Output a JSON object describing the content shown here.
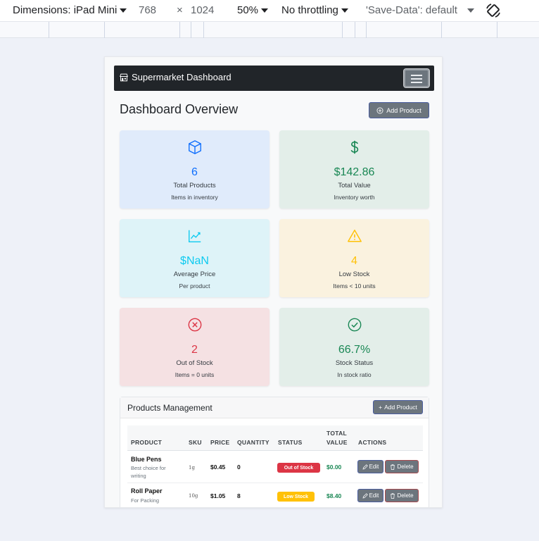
{
  "devtools": {
    "dimensions_label": "Dimensions: iPad Mini",
    "width": "768",
    "times": "×",
    "height": "1024",
    "zoom": "50%",
    "throttling": "No throttling",
    "save_data": "'Save-Data': default"
  },
  "navbar": {
    "brand": "Supermarket Dashboard"
  },
  "page": {
    "title": "Dashboard Overview",
    "add_product_label": "Add Product"
  },
  "cards": [
    {
      "value": "6",
      "label": "Total Products",
      "sub": "Items in inventory",
      "icon": "box-icon",
      "color": "#0d6efd",
      "bg": "#e0ebfb"
    },
    {
      "value": "$142.86",
      "label": "Total Value",
      "sub": "Inventory worth",
      "icon": "dollar-icon",
      "color": "#198754",
      "bg": "#e3eee9"
    },
    {
      "value": "$NaN",
      "label": "Average Price",
      "sub": "Per product",
      "icon": "chart-line-icon",
      "color": "#0dcaf0",
      "bg": "#def3f8"
    },
    {
      "value": "4",
      "label": "Low Stock",
      "sub": "Items < 10 units",
      "icon": "warning-icon",
      "color": "#ffc107",
      "bg": "#faf2df"
    },
    {
      "value": "2",
      "label": "Out of Stock",
      "sub": "Items = 0 units",
      "icon": "x-circle-icon",
      "color": "#dc3545",
      "bg": "#f5e1e3"
    },
    {
      "value": "66.7%",
      "label": "Stock Status",
      "sub": "In stock ratio",
      "icon": "check-circle-icon",
      "color": "#198754",
      "bg": "#e3eee9"
    }
  ],
  "products": {
    "title": "Products Management",
    "add_label": "Add Product",
    "columns": [
      "PRODUCT",
      "SKU",
      "PRICE",
      "QUANTITY",
      "STATUS",
      "TOTAL",
      "VALUE",
      "ACTIONS"
    ],
    "rows": [
      {
        "name": "Blue Pens",
        "desc1": "Best choice for",
        "desc2": "writing",
        "sku": "1g",
        "price": "$0.45",
        "quantity": "0",
        "status": "Out of Stock",
        "status_bg": "#dc3545",
        "status_fg": "#ffffff",
        "total": "$0.00"
      },
      {
        "name": "Roll Paper",
        "desc1": "For Packing",
        "desc2": "",
        "sku": "10g",
        "price": "$1.05",
        "quantity": "8",
        "status": "Low Stock",
        "status_bg": "#ffc107",
        "status_fg": "#ffffff",
        "total": "$8.40"
      }
    ],
    "edit_label": "Edit",
    "delete_label": "Delete"
  }
}
